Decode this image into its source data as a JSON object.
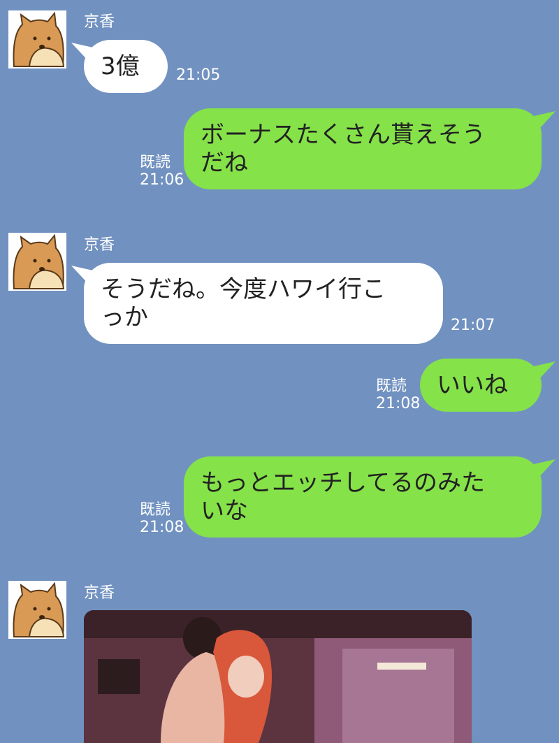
{
  "colors": {
    "background": "#7192c0",
    "incoming_bubble": "#ffffff",
    "outgoing_bubble": "#85e249"
  },
  "messages": [
    {
      "direction": "in",
      "sender": "京香",
      "text": "3億",
      "time": "21:05"
    },
    {
      "direction": "out",
      "text": "ボーナスたくさん貰えそう\nだね",
      "read": "既読",
      "time": "21:06"
    },
    {
      "direction": "in",
      "sender": "京香",
      "text": "そうだね。今度ハワイ行こ\nっか",
      "time": "21:07"
    },
    {
      "direction": "out",
      "text": "いいね",
      "read": "既読",
      "time": "21:08"
    },
    {
      "direction": "out",
      "text": "もっとエッチしてるのみた\nいな",
      "read": "既読",
      "time": "21:08"
    },
    {
      "direction": "in",
      "sender": "京香",
      "type": "image",
      "icon": "photo-image"
    }
  ]
}
